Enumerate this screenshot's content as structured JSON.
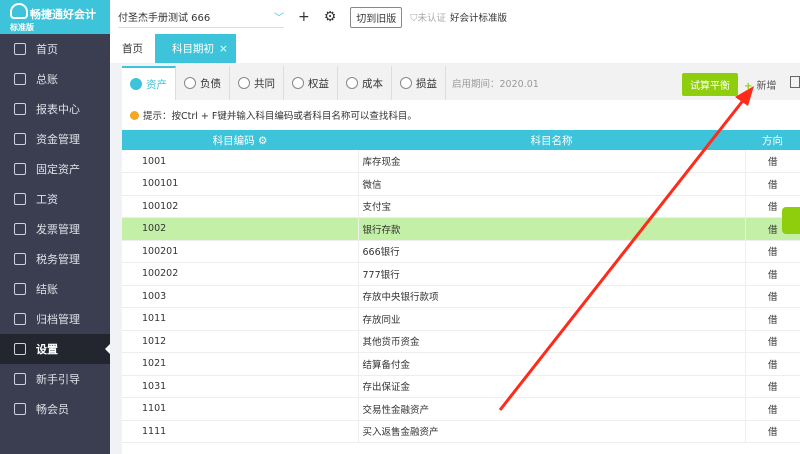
{
  "sidebar": {
    "logo": "畅捷通好会计",
    "edition": "标准版",
    "items": [
      {
        "label": "首页",
        "icon": "home-icon"
      },
      {
        "label": "总账",
        "icon": "ledger-icon"
      },
      {
        "label": "报表中心",
        "icon": "chart-icon"
      },
      {
        "label": "资金管理",
        "icon": "fund-icon"
      },
      {
        "label": "固定资产",
        "icon": "asset-icon"
      },
      {
        "label": "工资",
        "icon": "salary-icon"
      },
      {
        "label": "发票管理",
        "icon": "invoice-icon"
      },
      {
        "label": "税务管理",
        "icon": "tax-icon"
      },
      {
        "label": "结账",
        "icon": "close-icon"
      },
      {
        "label": "归档管理",
        "icon": "archive-icon"
      },
      {
        "label": "设置",
        "icon": "gear-icon",
        "active": true
      },
      {
        "label": "新手引导",
        "icon": "guide-icon"
      },
      {
        "label": "畅会员",
        "icon": "vip-icon"
      }
    ]
  },
  "topbar": {
    "account": "付圣杰手册测试 666",
    "add": "+",
    "switch_old": "切到旧版",
    "uncertified": "未认证",
    "edition": "好会计标准版"
  },
  "tabs": [
    {
      "label": "首页"
    },
    {
      "label": "科目期初",
      "close": "×"
    }
  ],
  "subtabs": [
    "资产",
    "负债",
    "共同",
    "权益",
    "成本",
    "损益"
  ],
  "period": "启用期间：2020.01",
  "trial_balance": "试算平衡",
  "add_new": "新增",
  "hint": "提示：按Ctrl + F键并输入科目编码或者科目名称可以查找科目。",
  "table": {
    "headers": [
      "科目编码",
      "科目名称",
      "方向"
    ],
    "rows": [
      [
        "1001",
        "库存现金",
        "借"
      ],
      [
        "100101",
        "微信",
        "借"
      ],
      [
        "100102",
        "支付宝",
        "借"
      ],
      [
        "1002",
        "银行存款",
        "借"
      ],
      [
        "100201",
        "666银行",
        "借"
      ],
      [
        "100202",
        "777银行",
        "借"
      ],
      [
        "1003",
        "存放中央银行款项",
        "借"
      ],
      [
        "1011",
        "存放同业",
        "借"
      ],
      [
        "1012",
        "其他货币资金",
        "借"
      ],
      [
        "1021",
        "结算备付金",
        "借"
      ],
      [
        "1031",
        "存出保证金",
        "借"
      ],
      [
        "1101",
        "交易性金融资产",
        "借"
      ],
      [
        "1111",
        "买入返售金融资产",
        "借"
      ]
    ],
    "highlight_row": 3
  },
  "colors": {
    "accent": "#3ec4da",
    "green": "#8fce0c",
    "sidebar": "#3b3e50",
    "arrow": "#ff2a1a"
  }
}
